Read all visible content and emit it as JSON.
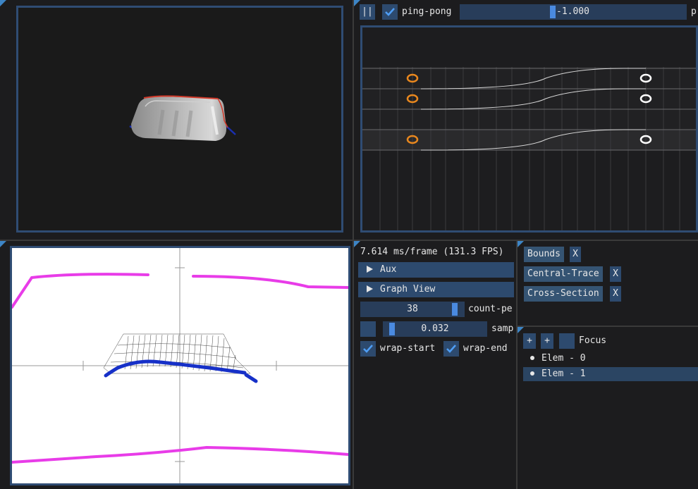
{
  "viewport3d": {
    "label": "3D viewport"
  },
  "timeline": {
    "pause_label": "||",
    "pingpong_label": "ping-pong",
    "pingpong_checked": true,
    "playback_value": "-1.000",
    "playback_fraction": 0.42,
    "truncated_label": "p",
    "keyframe_rows": 3
  },
  "stats": {
    "frame_time": "7.614 ms/frame (131.3 FPS)"
  },
  "sections": {
    "aux": "Aux",
    "graph_view": "Graph View"
  },
  "controls": {
    "count_value": "38",
    "count_label": "count-pe",
    "sample_value": "0.032",
    "sample_label": "samp",
    "wrap_start_label": "wrap-start",
    "wrap_start_checked": true,
    "wrap_end_label": "wrap-end",
    "wrap_end_checked": true
  },
  "layers": [
    {
      "label": "Bounds",
      "remove": "X"
    },
    {
      "label": "Central-Trace",
      "remove": "X"
    },
    {
      "label": "Cross-Section",
      "remove": "X"
    }
  ],
  "scene": {
    "add1": "+",
    "add2": "+",
    "focus_label": "Focus",
    "items": [
      {
        "label": "Elem - 0",
        "selected": false
      },
      {
        "label": "Elem - 1",
        "selected": true
      }
    ]
  },
  "colors": {
    "accent": "#2d4a6e",
    "frame": "#2f4c73",
    "grab": "#4a8ae0",
    "key_start": "#e8871e",
    "key_end": "#ffffff",
    "magenta_trace": "#e83ce8",
    "blue_trace": "#1630c8"
  }
}
